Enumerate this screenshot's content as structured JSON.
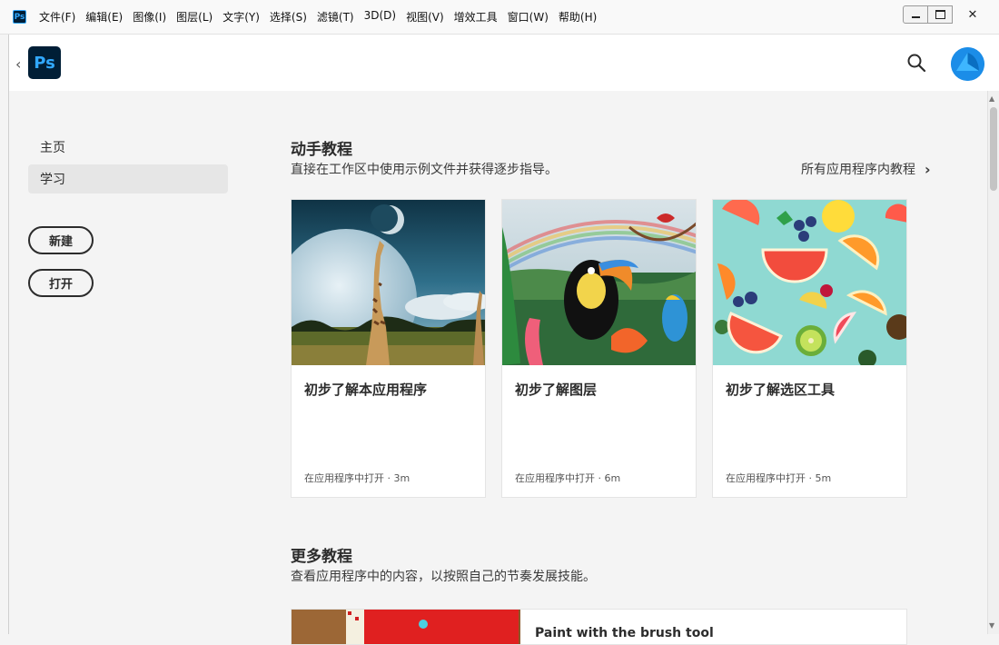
{
  "menubar": {
    "app_icon": "Ps",
    "items": [
      "文件(F)",
      "编辑(E)",
      "图像(I)",
      "图层(L)",
      "文字(Y)",
      "选择(S)",
      "滤镜(T)",
      "3D(D)",
      "视图(V)",
      "增效工具",
      "窗口(W)",
      "帮助(H)"
    ],
    "close_glyph": "✕"
  },
  "header": {
    "back_glyph": "‹",
    "logo": "Ps"
  },
  "sidebar": {
    "items": [
      {
        "label": "主页",
        "active": false
      },
      {
        "label": "学习",
        "active": true
      }
    ],
    "new_button": "新建",
    "open_button": "打开"
  },
  "hands_on": {
    "title": "动手教程",
    "subtitle": "直接在工作区中使用示例文件并获得逐步指导。",
    "all_link": "所有应用程序内教程",
    "cards": [
      {
        "title": "初步了解本应用程序",
        "meta": "在应用程序中打开 · 3m"
      },
      {
        "title": "初步了解图层",
        "meta": "在应用程序中打开 · 6m"
      },
      {
        "title": "初步了解选区工具",
        "meta": "在应用程序中打开 · 5m"
      }
    ]
  },
  "more_tutorials": {
    "title": "更多教程",
    "subtitle": "查看应用程序中的内容，以按照自己的节奏发展技能。",
    "first_item_title": "Paint with the brush tool"
  },
  "colors": {
    "accent": "#31a8ff",
    "logo_bg": "#001e36",
    "avatar": "#1b8de8"
  }
}
